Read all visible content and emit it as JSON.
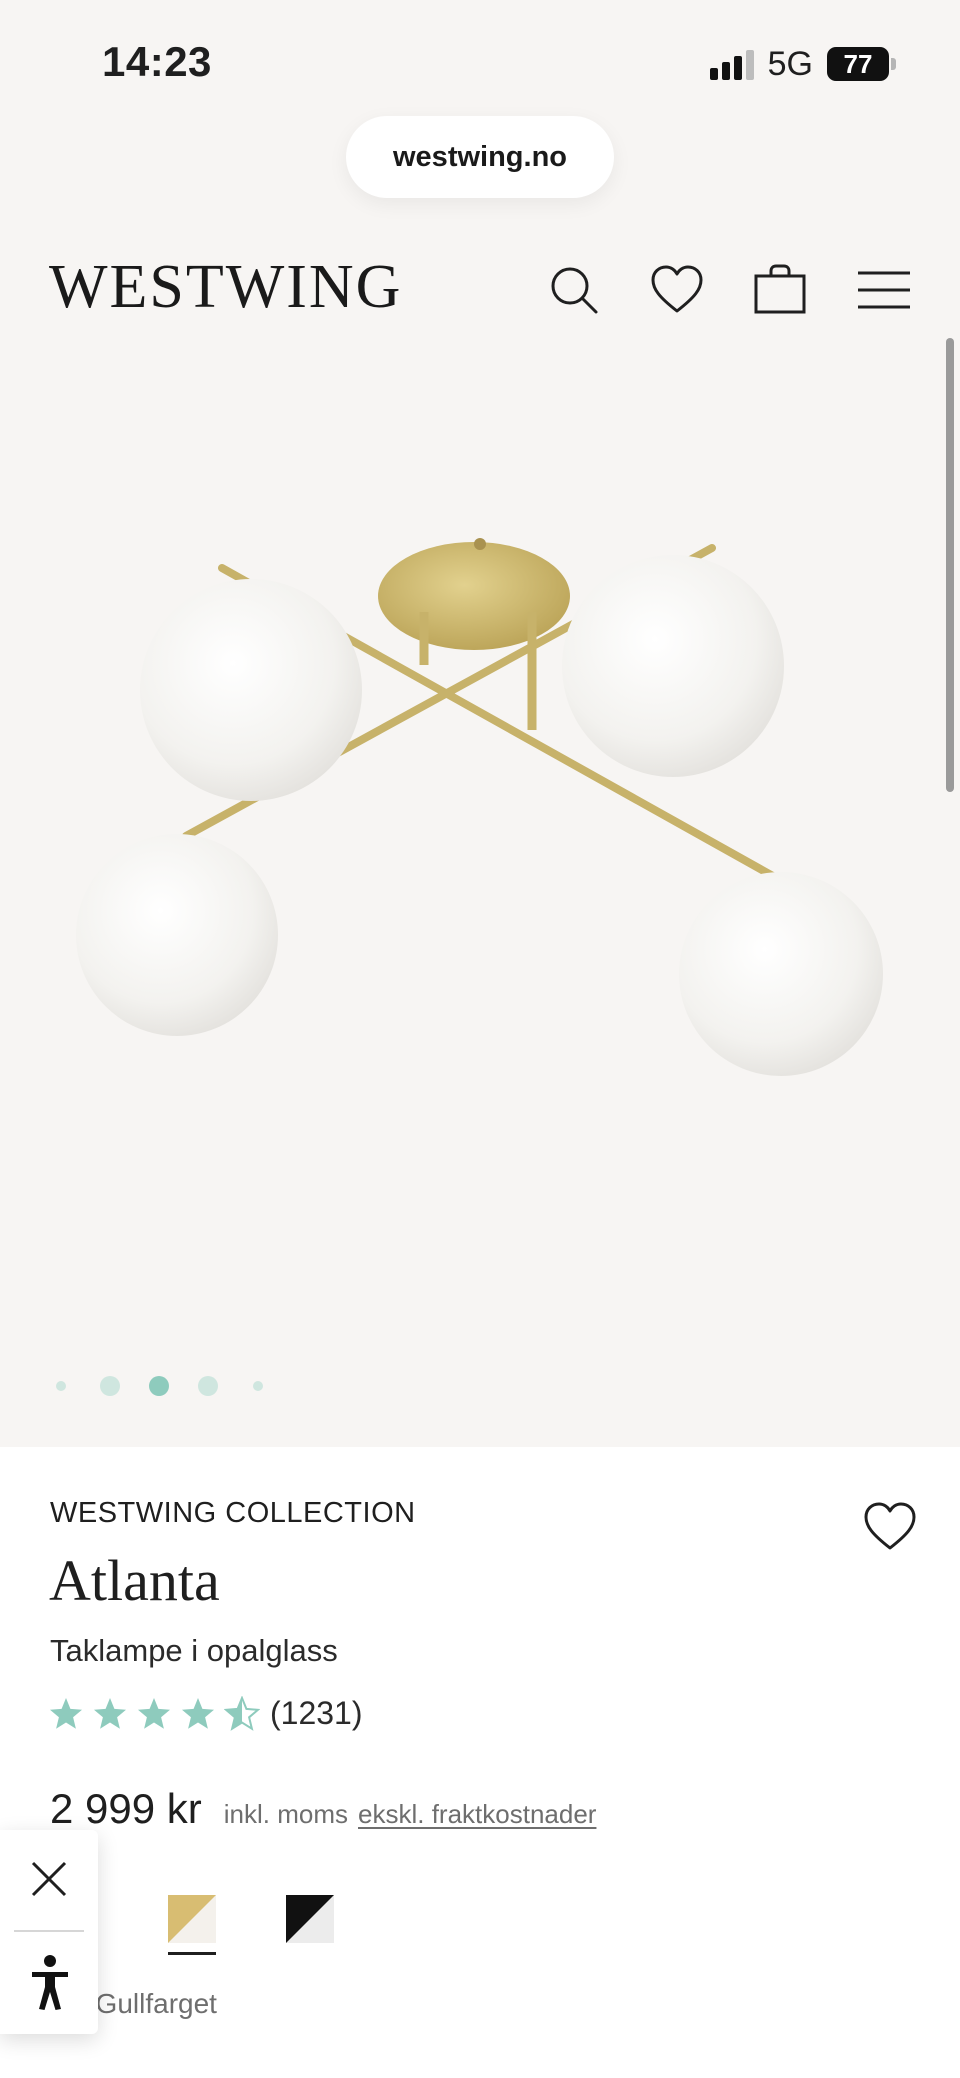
{
  "status_bar": {
    "time": "14:23",
    "network": "5G",
    "battery": "77"
  },
  "browser": {
    "url": "westwing.no"
  },
  "header": {
    "logo": "WESTWING",
    "icons": [
      "search-icon",
      "heart-icon",
      "shopping-bag-icon",
      "menu-icon"
    ]
  },
  "carousel": {
    "slide_count": 5,
    "active_index": 2
  },
  "product": {
    "brand": "WESTWING COLLECTION",
    "name": "Atlanta",
    "subtitle": "Taklampe i opalglass",
    "rating": 4.5,
    "rating_count": "(1231)",
    "price": "2 999 kr",
    "vat_note": "inkl. moms",
    "shipping_link": "ekskl. fraktkostnader",
    "selected_color_label": ", Gullfarget",
    "swatches": [
      "gold-white",
      "black-white"
    ]
  },
  "colors": {
    "accent_green": "#8ecbbd",
    "background": "#f7f5f3",
    "brass": "#c9b36a"
  }
}
